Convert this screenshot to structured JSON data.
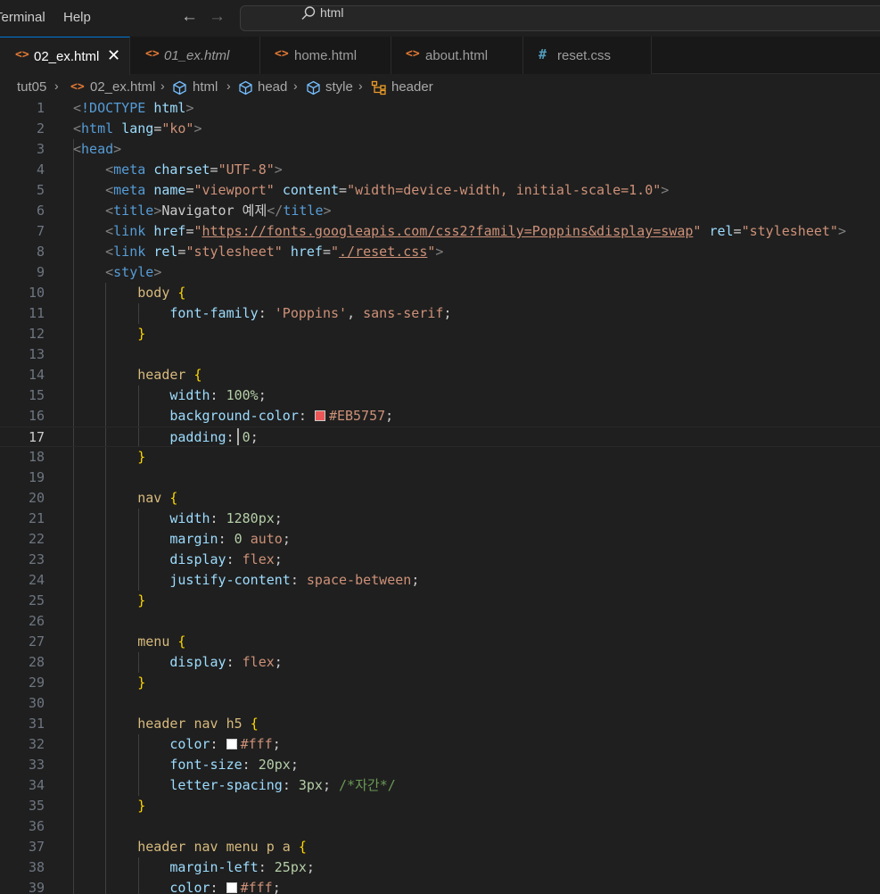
{
  "menu": {
    "terminal": "Terminal",
    "help": "Help"
  },
  "nav": {
    "back_icon": "arrow-left",
    "forward_icon": "arrow-right"
  },
  "search": {
    "icon": "search",
    "value": "html"
  },
  "tabs": [
    {
      "label": "02_ex.html",
      "icon": "<>",
      "active": true,
      "close": "✕"
    },
    {
      "label": "01_ex.html",
      "icon": "<>",
      "italic": true
    },
    {
      "label": "home.html",
      "icon": "<>"
    },
    {
      "label": "about.html",
      "icon": "<>"
    },
    {
      "label": "reset.css",
      "icon": "#"
    }
  ],
  "breadcrumb": [
    "tut05",
    "02_ex.html",
    "html",
    "head",
    "style",
    "header"
  ],
  "colors": {
    "accent": "#0078d4",
    "swatch_red": "#EB5757",
    "swatch_white": "#fff"
  },
  "editor": {
    "current_line": 17,
    "lines": [
      {
        "n": "1",
        "t": [
          [
            "punc",
            "<"
          ],
          [
            "tag",
            "!DOCTYPE "
          ],
          [
            "attr",
            "html"
          ],
          [
            "punc",
            ">"
          ]
        ]
      },
      {
        "n": "2",
        "t": [
          [
            "punc",
            "<"
          ],
          [
            "tag",
            "html "
          ],
          [
            "attr",
            "lang"
          ],
          [
            "txt",
            "="
          ],
          [
            "str",
            "\"ko\""
          ],
          [
            "punc",
            ">"
          ]
        ]
      },
      {
        "n": "3",
        "t": [
          [
            "punc",
            "<"
          ],
          [
            "tag",
            "head"
          ],
          [
            "punc",
            ">"
          ]
        ]
      },
      {
        "n": "4",
        "t": [
          [
            "txt",
            "    "
          ],
          [
            "punc",
            "<"
          ],
          [
            "tag",
            "meta "
          ],
          [
            "attr",
            "charset"
          ],
          [
            "txt",
            "="
          ],
          [
            "str",
            "\"UTF-8\""
          ],
          [
            "punc",
            ">"
          ]
        ]
      },
      {
        "n": "5",
        "t": [
          [
            "txt",
            "    "
          ],
          [
            "punc",
            "<"
          ],
          [
            "tag",
            "meta "
          ],
          [
            "attr",
            "name"
          ],
          [
            "txt",
            "="
          ],
          [
            "str",
            "\"viewport\""
          ],
          [
            "txt",
            " "
          ],
          [
            "attr",
            "content"
          ],
          [
            "txt",
            "="
          ],
          [
            "str",
            "\"width=device-width, initial-scale=1.0\""
          ],
          [
            "punc",
            ">"
          ]
        ]
      },
      {
        "n": "6",
        "t": [
          [
            "txt",
            "    "
          ],
          [
            "punc",
            "<"
          ],
          [
            "tag",
            "title"
          ],
          [
            "punc",
            ">"
          ],
          [
            "txt",
            "Navigator 예제"
          ],
          [
            "punc",
            "</"
          ],
          [
            "tag",
            "title"
          ],
          [
            "punc",
            ">"
          ]
        ]
      },
      {
        "n": "7",
        "t": [
          [
            "txt",
            "    "
          ],
          [
            "punc",
            "<"
          ],
          [
            "tag",
            "link "
          ],
          [
            "attr",
            "href"
          ],
          [
            "txt",
            "="
          ],
          [
            "str",
            "\""
          ],
          [
            "strlink",
            "https://fonts.googleapis.com/css2?family=Poppins&display=swap"
          ],
          [
            "str",
            "\""
          ],
          [
            "txt",
            " "
          ],
          [
            "attr",
            "rel"
          ],
          [
            "txt",
            "="
          ],
          [
            "str",
            "\"stylesheet\""
          ],
          [
            "punc",
            ">"
          ]
        ]
      },
      {
        "n": "8",
        "t": [
          [
            "txt",
            "    "
          ],
          [
            "punc",
            "<"
          ],
          [
            "tag",
            "link "
          ],
          [
            "attr",
            "rel"
          ],
          [
            "txt",
            "="
          ],
          [
            "str",
            "\"stylesheet\""
          ],
          [
            "txt",
            " "
          ],
          [
            "attr",
            "href"
          ],
          [
            "txt",
            "="
          ],
          [
            "str",
            "\""
          ],
          [
            "strlink",
            "./reset.css"
          ],
          [
            "str",
            "\""
          ],
          [
            "punc",
            ">"
          ]
        ]
      },
      {
        "n": "9",
        "t": [
          [
            "txt",
            "    "
          ],
          [
            "punc",
            "<"
          ],
          [
            "tag",
            "style"
          ],
          [
            "punc",
            ">"
          ]
        ]
      },
      {
        "n": "10",
        "t": [
          [
            "txt",
            "        "
          ],
          [
            "sel",
            "body "
          ],
          [
            "brace",
            "{"
          ]
        ]
      },
      {
        "n": "11",
        "t": [
          [
            "txt",
            "            "
          ],
          [
            "prop",
            "font-family"
          ],
          [
            "txt",
            ": "
          ],
          [
            "kw",
            "'Poppins'"
          ],
          [
            "txt",
            ", "
          ],
          [
            "kw",
            "sans-serif"
          ],
          [
            "txt",
            ";"
          ]
        ]
      },
      {
        "n": "12",
        "t": [
          [
            "txt",
            "        "
          ],
          [
            "brace",
            "}"
          ]
        ]
      },
      {
        "n": "13",
        "t": []
      },
      {
        "n": "14",
        "t": [
          [
            "txt",
            "        "
          ],
          [
            "sel",
            "header "
          ],
          [
            "brace",
            "{"
          ]
        ]
      },
      {
        "n": "15",
        "t": [
          [
            "txt",
            "            "
          ],
          [
            "prop",
            "width"
          ],
          [
            "txt",
            ": "
          ],
          [
            "num",
            "100%"
          ],
          [
            "txt",
            ";"
          ]
        ]
      },
      {
        "n": "16",
        "t": [
          [
            "txt",
            "            "
          ],
          [
            "prop",
            "background-color"
          ],
          [
            "txt",
            ": "
          ],
          [
            "swatch",
            "#EB5757"
          ],
          [
            "kw",
            "#EB5757"
          ],
          [
            "txt",
            ";"
          ]
        ]
      },
      {
        "n": "17",
        "t": [
          [
            "txt",
            "            "
          ],
          [
            "prop",
            "padding"
          ],
          [
            "txt",
            ": "
          ],
          [
            "num",
            "0"
          ],
          [
            "txt",
            ";"
          ]
        ]
      },
      {
        "n": "18",
        "t": [
          [
            "txt",
            "        "
          ],
          [
            "brace",
            "}"
          ]
        ]
      },
      {
        "n": "19",
        "t": []
      },
      {
        "n": "20",
        "t": [
          [
            "txt",
            "        "
          ],
          [
            "sel",
            "nav "
          ],
          [
            "brace",
            "{"
          ]
        ]
      },
      {
        "n": "21",
        "t": [
          [
            "txt",
            "            "
          ],
          [
            "prop",
            "width"
          ],
          [
            "txt",
            ": "
          ],
          [
            "num",
            "1280px"
          ],
          [
            "txt",
            ";"
          ]
        ]
      },
      {
        "n": "22",
        "t": [
          [
            "txt",
            "            "
          ],
          [
            "prop",
            "margin"
          ],
          [
            "txt",
            ": "
          ],
          [
            "num",
            "0"
          ],
          [
            "txt",
            " "
          ],
          [
            "kw",
            "auto"
          ],
          [
            "txt",
            ";"
          ]
        ]
      },
      {
        "n": "23",
        "t": [
          [
            "txt",
            "            "
          ],
          [
            "prop",
            "display"
          ],
          [
            "txt",
            ": "
          ],
          [
            "kw",
            "flex"
          ],
          [
            "txt",
            ";"
          ]
        ]
      },
      {
        "n": "24",
        "t": [
          [
            "txt",
            "            "
          ],
          [
            "prop",
            "justify-content"
          ],
          [
            "txt",
            ": "
          ],
          [
            "kw",
            "space-between"
          ],
          [
            "txt",
            ";"
          ]
        ]
      },
      {
        "n": "25",
        "t": [
          [
            "txt",
            "        "
          ],
          [
            "brace",
            "}"
          ]
        ]
      },
      {
        "n": "26",
        "t": []
      },
      {
        "n": "27",
        "t": [
          [
            "txt",
            "        "
          ],
          [
            "sel",
            "menu "
          ],
          [
            "brace",
            "{"
          ]
        ]
      },
      {
        "n": "28",
        "t": [
          [
            "txt",
            "            "
          ],
          [
            "prop",
            "display"
          ],
          [
            "txt",
            ": "
          ],
          [
            "kw",
            "flex"
          ],
          [
            "txt",
            ";"
          ]
        ]
      },
      {
        "n": "29",
        "t": [
          [
            "txt",
            "        "
          ],
          [
            "brace",
            "}"
          ]
        ]
      },
      {
        "n": "30",
        "t": []
      },
      {
        "n": "31",
        "t": [
          [
            "txt",
            "        "
          ],
          [
            "sel",
            "header nav h5 "
          ],
          [
            "brace",
            "{"
          ]
        ]
      },
      {
        "n": "32",
        "t": [
          [
            "txt",
            "            "
          ],
          [
            "prop",
            "color"
          ],
          [
            "txt",
            ": "
          ],
          [
            "swatch",
            "#fff"
          ],
          [
            "kw",
            "#fff"
          ],
          [
            "txt",
            ";"
          ]
        ]
      },
      {
        "n": "33",
        "t": [
          [
            "txt",
            "            "
          ],
          [
            "prop",
            "font-size"
          ],
          [
            "txt",
            ": "
          ],
          [
            "num",
            "20px"
          ],
          [
            "txt",
            ";"
          ]
        ]
      },
      {
        "n": "34",
        "t": [
          [
            "txt",
            "            "
          ],
          [
            "prop",
            "letter-spacing"
          ],
          [
            "txt",
            ": "
          ],
          [
            "num",
            "3px"
          ],
          [
            "txt",
            "; "
          ],
          [
            "cmt",
            "/*자간*/"
          ]
        ]
      },
      {
        "n": "35",
        "t": [
          [
            "txt",
            "        "
          ],
          [
            "brace",
            "}"
          ]
        ]
      },
      {
        "n": "36",
        "t": []
      },
      {
        "n": "37",
        "t": [
          [
            "txt",
            "        "
          ],
          [
            "sel",
            "header nav menu p a "
          ],
          [
            "brace",
            "{"
          ]
        ]
      },
      {
        "n": "38",
        "t": [
          [
            "txt",
            "            "
          ],
          [
            "prop",
            "margin-left"
          ],
          [
            "txt",
            ": "
          ],
          [
            "num",
            "25px"
          ],
          [
            "txt",
            ";"
          ]
        ]
      },
      {
        "n": "39",
        "t": [
          [
            "txt",
            "            "
          ],
          [
            "prop",
            "color"
          ],
          [
            "txt",
            ": "
          ],
          [
            "swatch",
            "#fff"
          ],
          [
            "kw",
            "#fff"
          ],
          [
            "txt",
            ";"
          ]
        ]
      }
    ]
  }
}
